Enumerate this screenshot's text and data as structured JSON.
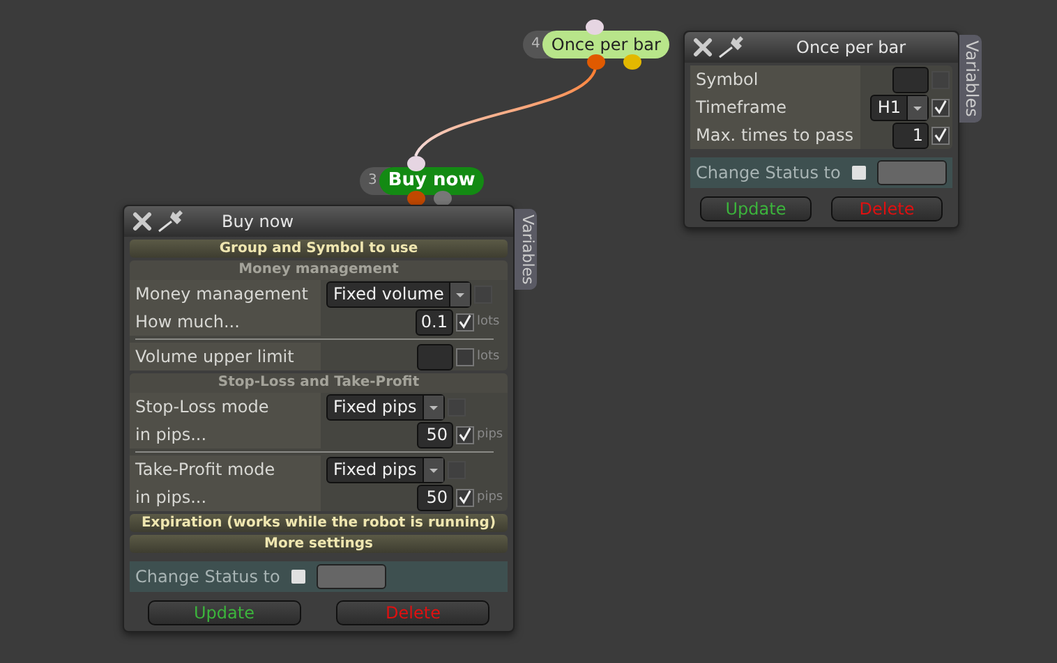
{
  "nodes": [
    {
      "number": "4",
      "label": "Once per bar",
      "color": "#b8e58a"
    },
    {
      "number": "3",
      "label": "Buy now",
      "color": "#138a13"
    }
  ],
  "panels": [
    {
      "title": "Once per bar",
      "side_tab": "Variables",
      "sections": [
        {
          "kind": "plain",
          "blocks": [
            [
              {
                "kind": "input",
                "label": "Symbol",
                "checked": false,
                "disabled": true
              },
              {
                "kind": "select",
                "label": "Timeframe",
                "value": "H1",
                "checked": true,
                "disabled": false
              },
              {
                "kind": "input",
                "label": "Max. times to pass",
                "value": "1",
                "checked": true,
                "disabled": false
              }
            ]
          ]
        }
      ],
      "status": {
        "label": "Change Status to",
        "checked": false
      },
      "buttons": [
        {
          "label": "Update",
          "kind": "update"
        },
        {
          "label": "Delete",
          "kind": "delete"
        }
      ]
    },
    {
      "title": "Buy now",
      "side_tab": "Variables",
      "sections": [
        {
          "kind": "header",
          "title": "Group and Symbol to use"
        },
        {
          "kind": "group",
          "title": "Money management",
          "blocks": [
            [
              {
                "kind": "select",
                "label": "Money management",
                "value": "Fixed volume",
                "checked": false,
                "disabled": true
              },
              {
                "kind": "input",
                "label": "How much...",
                "value": "0.1",
                "checked": true,
                "disabled": false,
                "unit": "lots"
              }
            ],
            [
              {
                "kind": "input",
                "label": "Volume upper limit",
                "checked": false,
                "disabled": false,
                "unit": "lots"
              }
            ]
          ]
        },
        {
          "kind": "group",
          "title": "Stop-Loss and Take-Profit",
          "blocks": [
            [
              {
                "kind": "select",
                "label": "Stop-Loss mode",
                "value": "Fixed pips",
                "checked": false,
                "disabled": true
              },
              {
                "kind": "input",
                "label": "in pips...",
                "value": "50",
                "checked": true,
                "disabled": false,
                "unit": "pips"
              }
            ],
            [
              {
                "kind": "select",
                "label": "Take-Profit mode",
                "value": "Fixed pips",
                "checked": false,
                "disabled": true
              },
              {
                "kind": "input",
                "label": "in pips...",
                "value": "50",
                "checked": true,
                "disabled": false,
                "unit": "pips"
              }
            ]
          ]
        },
        {
          "kind": "header",
          "title": "Expiration (works while the robot is running)"
        },
        {
          "kind": "header",
          "title": "More settings"
        }
      ],
      "status": {
        "label": "Change Status to",
        "checked": false
      },
      "buttons": [
        {
          "label": "Update",
          "kind": "update"
        },
        {
          "label": "Delete",
          "kind": "delete"
        }
      ]
    }
  ]
}
